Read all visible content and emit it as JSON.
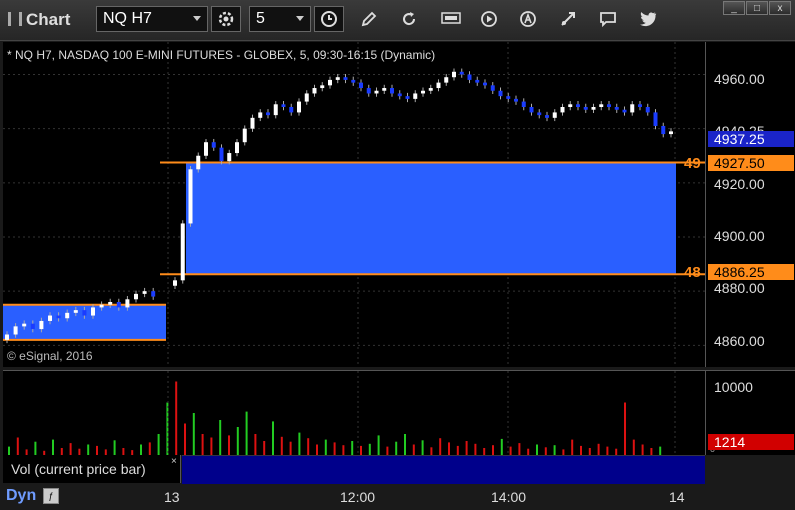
{
  "app": {
    "title": "Chart"
  },
  "toolbar": {
    "symbol": "NQ H7",
    "interval": "5",
    "buttons": [
      "settings-gear",
      "clock",
      "pencil-draw",
      "refresh",
      "get-data",
      "play",
      "analytics",
      "cursor-tool",
      "comment",
      "twitter"
    ]
  },
  "window_buttons": {
    "minimize": "_",
    "restore": "□",
    "close": "x"
  },
  "chart": {
    "header": "* NQ H7, NASDAQ 100 E-MINI FUTURES - GLOBEX, 5, 09:30-16:15 (Dynamic)",
    "copyright": "© eSignal, 2016",
    "price_axis": [
      "4960.00",
      "4940.25",
      "4920.00",
      "4900.00",
      "4880.00",
      "4860.00"
    ],
    "last_price_tag": "4937.25",
    "level_upper": {
      "tag": "4927.50",
      "label": "49"
    },
    "level_lower": {
      "tag": "4886.25",
      "label": "48"
    },
    "colors": {
      "up": "#ffffff",
      "down": "#1a3cff",
      "zone": "#2a5fff",
      "level_line": "#ff8c1a",
      "last_tag": "#1a24c8"
    }
  },
  "chart_data": {
    "type": "candlestick",
    "price_range": [
      4852,
      4972
    ],
    "prev_session_close": [
      4864,
      4867,
      4868,
      4866,
      4869,
      4871,
      4870,
      4872,
      4873,
      4871,
      4874,
      4875,
      4876,
      4874,
      4877,
      4879,
      4880,
      4878
    ],
    "session_open": [
      4884,
      4905,
      4925,
      4930,
      4935,
      4933,
      4928,
      4931,
      4935,
      4940,
      4944,
      4946,
      4945,
      4949,
      4948,
      4946,
      4950,
      4953,
      4955,
      4956,
      4958,
      4959,
      4958,
      4957,
      4955,
      4953,
      4954,
      4955,
      4953,
      4952,
      4951,
      4953,
      4954,
      4955,
      4957,
      4959,
      4961,
      4960,
      4958,
      4957,
      4956,
      4954,
      4952,
      4951,
      4950,
      4948,
      4946,
      4945,
      4944,
      4946,
      4948,
      4949,
      4948,
      4947,
      4948,
      4949,
      4948,
      4947,
      4946,
      4949,
      4948,
      4946,
      4941,
      4938,
      4939
    ],
    "prev_zone": {
      "from": 4875,
      "to": 4862
    },
    "zone": {
      "from": 4927.5,
      "to": 4886.25
    },
    "volume": {
      "ymax": 12000,
      "tick": "10000",
      "last": "1214"
    },
    "time_labels": [
      "13",
      "12:00",
      "14:00",
      "14"
    ]
  },
  "volume_panel": {
    "legend": "Vol (current price bar)",
    "close": "×",
    "tick": "10000",
    "tick_low": "0",
    "last_tag": "1214"
  },
  "bottom": {
    "mode": "Dyn"
  }
}
